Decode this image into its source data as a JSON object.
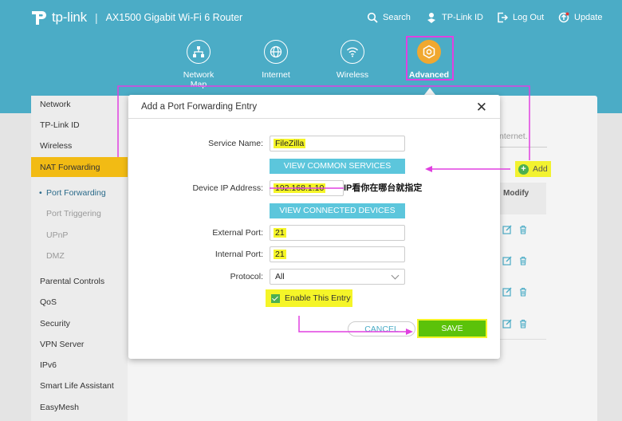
{
  "header": {
    "brand": "tp-link",
    "model": "AX1500 Gigabit Wi-Fi 6 Router",
    "nav": [
      {
        "label": "Search",
        "icon": "search-icon"
      },
      {
        "label": "TP-Link ID",
        "icon": "user-id-icon"
      },
      {
        "label": "Log Out",
        "icon": "logout-icon"
      },
      {
        "label": "Update",
        "icon": "update-icon"
      }
    ]
  },
  "tabs": [
    {
      "label": "Network Map",
      "icon": "network-map-icon"
    },
    {
      "label": "Internet",
      "icon": "globe-icon"
    },
    {
      "label": "Wireless",
      "icon": "wifi-icon"
    },
    {
      "label": "Advanced",
      "icon": "gear-icon",
      "active": true
    }
  ],
  "sidebar": {
    "items": [
      "Network",
      "TP-Link ID",
      "Wireless",
      "NAT Forwarding"
    ],
    "sub_items": [
      "Port Forwarding",
      "Port Triggering",
      "UPnP",
      "DMZ"
    ],
    "items_after": [
      "Parental Controls",
      "QoS",
      "Security",
      "VPN Server",
      "IPv6",
      "Smart Life Assistant",
      "EasyMesh"
    ]
  },
  "background": {
    "note_fragment": "nternet.",
    "add_label": "Add",
    "modify_header": "Modify"
  },
  "modal": {
    "title": "Add a Port Forwarding Entry",
    "close": "✕",
    "service_name_label": "Service Name:",
    "service_name_value": "FileZilla",
    "view_common_services": "VIEW COMMON SERVICES",
    "device_ip_label": "Device IP Address:",
    "device_ip_value": "192.168.1.10",
    "view_connected_devices": "VIEW CONNECTED DEVICES",
    "external_port_label": "External Port:",
    "external_port_value": "21",
    "internal_port_label": "Internal Port:",
    "internal_port_value": "21",
    "protocol_label": "Protocol:",
    "protocol_value": "All",
    "enable_label": "Enable This Entry",
    "enable_checked": true,
    "cancel_label": "CANCEL",
    "save_label": "SAVE"
  },
  "annotation": {
    "text": "IP看你在哪台就指定"
  },
  "colors": {
    "header_bg": "#4bacc6",
    "accent_blue": "#5cc6dc",
    "active_yellow": "#f2bb14",
    "highlight": "#f5f528",
    "save_green": "#5bc20a",
    "annotation_magenta": "#e040e0"
  }
}
